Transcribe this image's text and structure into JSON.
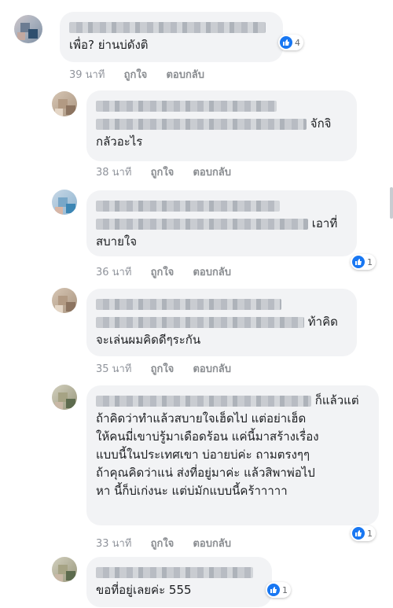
{
  "comments": [
    {
      "text": "เพื่อ? ย่านบ่ดังติ",
      "time": "39 นาที",
      "like_label": "ถูกใจ",
      "reply_label": "ตอบกลับ",
      "reaction_count": "4"
    },
    {
      "text_line1": "จักจิ",
      "text_line2": "กลัวอะไร",
      "time": "38 นาที",
      "like_label": "ถูกใจ",
      "reply_label": "ตอบกลับ"
    },
    {
      "text_line1": "เอาที่",
      "text_line2": "สบายใจ",
      "time": "36 นาที",
      "like_label": "ถูกใจ",
      "reply_label": "ตอบกลับ",
      "reaction_count": "1"
    },
    {
      "text_line1": "ท้าคิด",
      "text_line2": "จะเล่นผมคิดดีๆระกัน",
      "time": "35 นาที",
      "like_label": "ถูกใจ",
      "reply_label": "ตอบกลับ"
    },
    {
      "text_line1": "ก็แล้วแต่",
      "text_line2": "ถ้าคิดว่าทำแล้วสบายใจเฮ็ดไป แต่อย่าเฮ็ด",
      "text_line3": "ให้คนมี่เขาบ่รู้มาเดือดร้อน แค่นี้มาสร้างเรื่อง",
      "text_line4": "แบบนี้ในประเทศเขา บ่อายบ่ค่ะ ถามตรงๆๆ",
      "text_line5": "ถ้าคุณคิดว่าแน่ ส่งที่อยู่มาค่ะ แล้วสิพาพ่อไป",
      "text_line6": "หา นี้ก็บ่เก่งนะ แต่บ่มักแบบนี้คร้าาาาา",
      "time": "33 นาที",
      "like_label": "ถูกใจ",
      "reply_label": "ตอบกลับ",
      "reaction_count": "1"
    },
    {
      "text": "ขอที่อยู่เลยค่ะ 555",
      "reaction_count": "1"
    }
  ],
  "colors": {
    "like_blue": "#1877f2",
    "bubble_bg": "#f2f3f5",
    "meta_gray": "#90949c"
  },
  "icons": {
    "reaction": "thumbs-up-icon"
  }
}
